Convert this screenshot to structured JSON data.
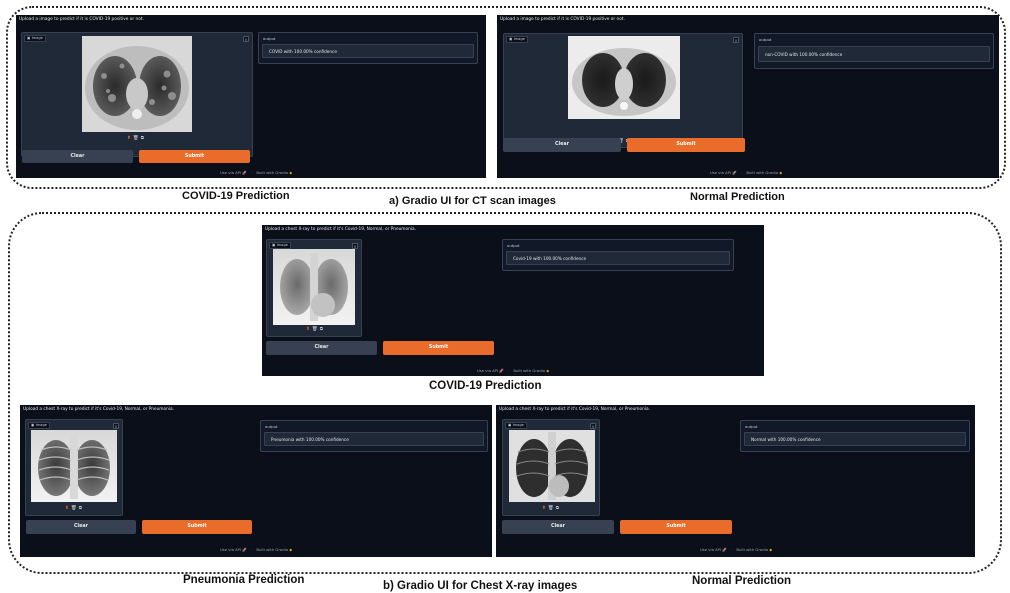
{
  "sections": {
    "ct": {
      "caption": "a) Gradio UI for CT scan images",
      "panels": [
        {
          "caption": "COVID-19 Prediction",
          "description": "Upload a image to predict if it is COVID-19 positive or not.",
          "image_label": "Image",
          "output_label": "output",
          "output_value": "COVID with 100.00% confidence"
        },
        {
          "caption": "Normal Prediction",
          "description": "Upload a image to predict if it is COVID-19 positive or not.",
          "image_label": "Image",
          "output_label": "output",
          "output_value": "non-COVID with 100.00% confidence"
        }
      ]
    },
    "xray": {
      "caption": "b) Gradio UI for Chest X-ray images",
      "panels": [
        {
          "caption": "COVID-19 Prediction",
          "description": "Upload a chest X-ray to predict if it's Covid-19, Normal, or Pneumonia.",
          "image_label": "Image",
          "output_label": "output",
          "output_value": "Covid-19 with 100.00% confidence"
        },
        {
          "caption": "Pneumonia Prediction",
          "description": "Upload a chest X-ray to predict if it's Covid-19, Normal, or Pneumonia.",
          "image_label": "Image",
          "output_label": "output",
          "output_value": "Pneumonia with 100.00% confidence"
        },
        {
          "caption": "Normal Prediction",
          "description": "Upload a chest X-ray to predict if it's Covid-19, Normal, or Pneumonia.",
          "image_label": "Image",
          "output_label": "output",
          "output_value": "Normal with 100.00% confidence"
        }
      ]
    }
  },
  "buttons": {
    "clear": "Clear",
    "submit": "Submit"
  },
  "footer": {
    "api": "Use via API",
    "built": "Built with Gradio"
  },
  "icons": {
    "image_tag": "image-icon",
    "close": "close-icon",
    "upload": "upload-icon",
    "delete": "trash-icon",
    "clipboard": "clipboard-icon",
    "api": "rocket-icon",
    "gradio": "gradio-logo-icon"
  },
  "colors": {
    "panel_bg": "#0b0f19",
    "block_bg": "#1f2937",
    "border": "#374151",
    "clear_button": "#374151",
    "submit_button": "#ea6c2a",
    "accent": "#f97316"
  }
}
